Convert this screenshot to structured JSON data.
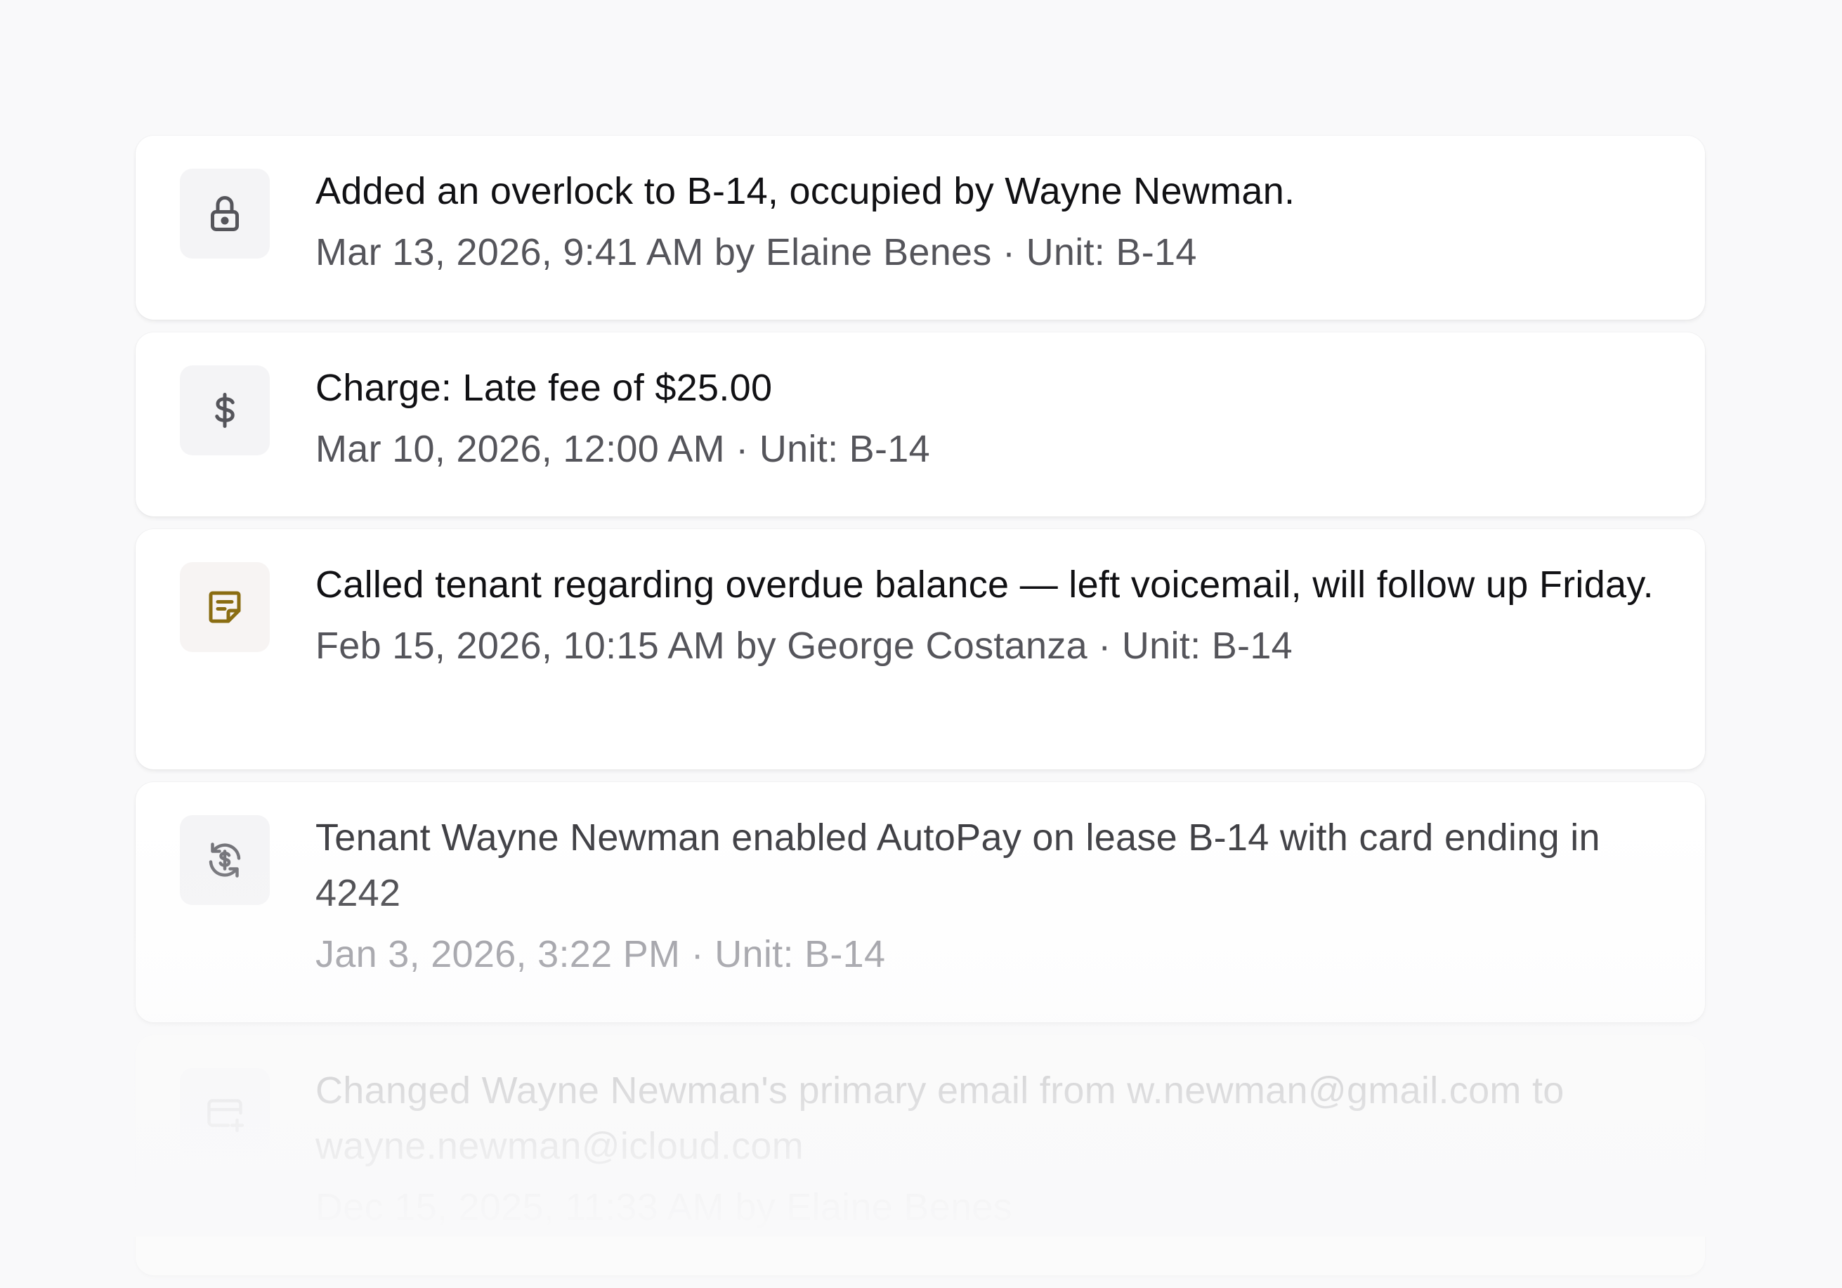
{
  "activity": [
    {
      "icon": "lock-icon",
      "title": "Added an overlock to B-14, occupied by Wayne Newman.",
      "meta": "Mar 13, 2026, 9:41 AM by Elaine Benes · Unit: B-14"
    },
    {
      "icon": "dollar-icon",
      "title": "Charge: Late fee of $25.00",
      "meta": "Mar 10, 2026, 12:00 AM · Unit: B-14"
    },
    {
      "icon": "note-icon",
      "icon_color": "#8a6d12",
      "title": "Called tenant regarding overdue balance — left voicemail, will follow up Friday.",
      "meta": "Feb 15, 2026, 10:15 AM by George Costanza · Unit: B-14"
    },
    {
      "icon": "autopay-icon",
      "title": "Tenant Wayne Newman enabled AutoPay on lease B-14 with card ending in 4242",
      "meta": "Jan 3, 2026, 3:22 PM · Unit: B-14"
    },
    {
      "icon": "card-add-icon",
      "title": "Changed Wayne Newman's primary email from w.newman@gmail.com to wayne.newman@icloud.com",
      "meta": "Dec 15, 2025, 11:33 AM by Elaine Benes"
    }
  ]
}
